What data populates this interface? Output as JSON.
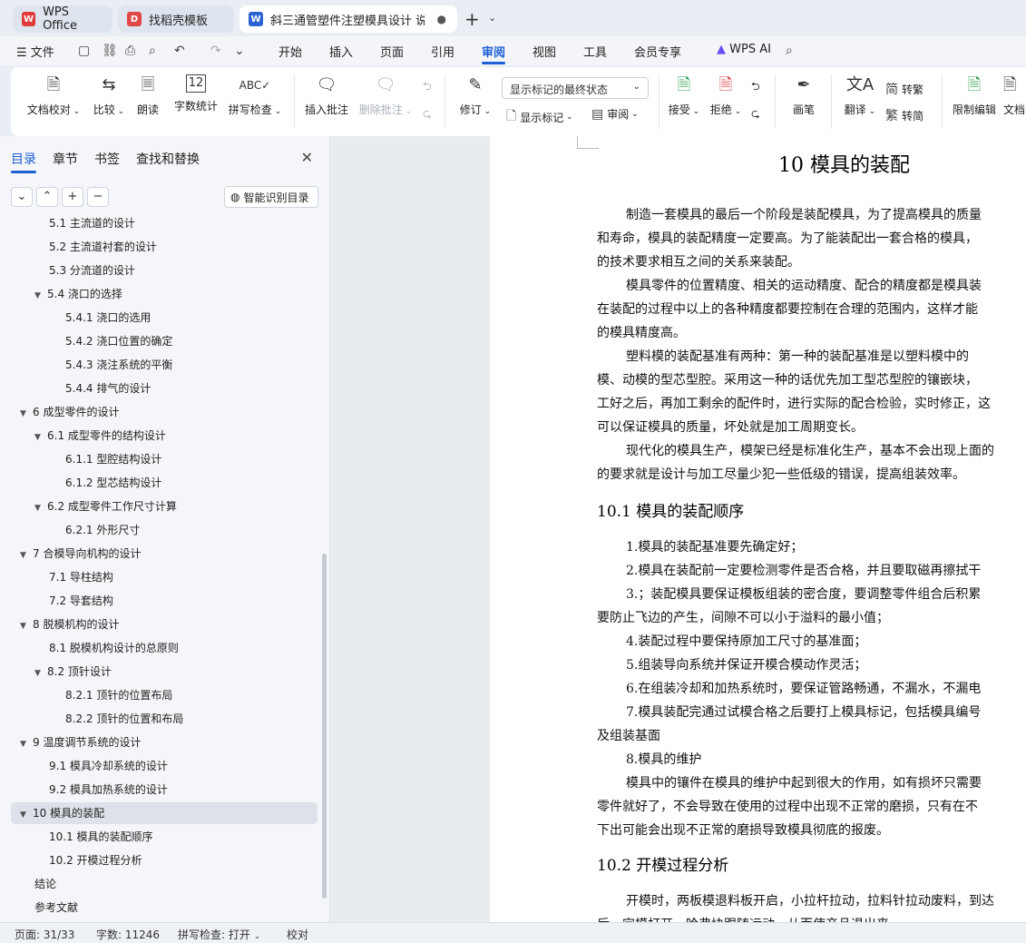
{
  "tabs": [
    {
      "label": "WPS Office",
      "icon": "wps-logo-icon",
      "color": "#e03a3a"
    },
    {
      "label": "找稻壳模板",
      "icon": "docer-icon",
      "color": "#e04848"
    },
    {
      "label": "斜三通管塑件注塑模具设计 说",
      "icon": "writer-doc-icon",
      "color": "#2b62d6"
    }
  ],
  "menu": {
    "file": "文件",
    "items": [
      "开始",
      "插入",
      "页面",
      "引用",
      "审阅",
      "视图",
      "工具",
      "会员专享"
    ],
    "active": "审阅",
    "wps_ai": "WPS AI"
  },
  "ribbon": {
    "doc_check": "文档校对",
    "compare": "比较",
    "read_aloud": "朗读",
    "word_count": "字数统计",
    "spell_check": "拼写检查",
    "insert_comment": "插入批注",
    "delete_comment": "删除批注",
    "revise": "修订",
    "display_mode": "显示标记的最终状态",
    "show_markup": "显示标记",
    "review": "审阅",
    "accept": "接受",
    "reject": "拒绝",
    "draw": "画笔",
    "translate": "翻译",
    "to_traditional": "转繁",
    "to_simplified": "转简",
    "restrict_edit": "限制编辑",
    "doc_right": "文档"
  },
  "panel": {
    "tabs": [
      "目录",
      "章节",
      "书签",
      "查找和替换"
    ],
    "active_tab": "目录",
    "smart_toc": "智能识别目录"
  },
  "toc": [
    {
      "text": "5.1 主流道的设计",
      "level": 2,
      "arrow": false
    },
    {
      "text": "5.2 主流道衬套的设计",
      "level": 2,
      "arrow": false
    },
    {
      "text": "5.3 分流道的设计",
      "level": 2,
      "arrow": false
    },
    {
      "text": "5.4 浇口的选择",
      "level": 2,
      "arrow": true
    },
    {
      "text": "5.4.1 浇口的选用",
      "level": 3,
      "arrow": false
    },
    {
      "text": "5.4.2 浇口位置的确定",
      "level": 3,
      "arrow": false
    },
    {
      "text": "5.4.3 浇注系统的平衡",
      "level": 3,
      "arrow": false
    },
    {
      "text": "5.4.4 排气的设计",
      "level": 3,
      "arrow": false
    },
    {
      "text": "6 成型零件的设计",
      "level": 1,
      "arrow": true
    },
    {
      "text": "6.1 成型零件的结构设计",
      "level": 2,
      "arrow": true
    },
    {
      "text": "6.1.1 型腔结构设计",
      "level": 3,
      "arrow": false
    },
    {
      "text": "6.1.2 型芯结构设计",
      "level": 3,
      "arrow": false
    },
    {
      "text": "6.2 成型零件工作尺寸计算",
      "level": 2,
      "arrow": true
    },
    {
      "text": "6.2.1 外形尺寸",
      "level": 3,
      "arrow": false
    },
    {
      "text": "7 合模导向机构的设计",
      "level": 1,
      "arrow": true
    },
    {
      "text": "7.1 导柱结构",
      "level": 2,
      "arrow": false
    },
    {
      "text": "7.2 导套结构",
      "level": 2,
      "arrow": false
    },
    {
      "text": "8 脱模机构的设计",
      "level": 1,
      "arrow": true
    },
    {
      "text": "8.1 脱模机构设计的总原则",
      "level": 2,
      "arrow": false
    },
    {
      "text": "8.2 顶针设计",
      "level": 2,
      "arrow": true
    },
    {
      "text": "8.2.1 顶针的位置布局",
      "level": 3,
      "arrow": false
    },
    {
      "text": "8.2.2 顶针的位置和布局",
      "level": 3,
      "arrow": false
    },
    {
      "text": "9 温度调节系统的设计",
      "level": 1,
      "arrow": true
    },
    {
      "text": "9.1 模具冷却系统的设计",
      "level": 2,
      "arrow": false
    },
    {
      "text": "9.2 模具加热系统的设计",
      "level": 2,
      "arrow": false
    },
    {
      "text": "10 模具的装配",
      "level": 1,
      "arrow": true,
      "selected": true
    },
    {
      "text": "10.1 模具的装配顺序",
      "level": 2,
      "arrow": false
    },
    {
      "text": "10.2 开模过程分析",
      "level": 2,
      "arrow": false
    },
    {
      "text": "结论",
      "level": 1,
      "arrow": false
    },
    {
      "text": "参考文献",
      "level": 1,
      "arrow": false
    }
  ],
  "document": {
    "title": "10  模具的装配",
    "lines_a": [
      {
        "text": "制造一套模具的最后一个阶段是装配模具，为了提高模具的质量",
        "indent": true
      },
      {
        "text": "和寿命，模具的装配精度一定要高。为了能装配出一套合格的模具，",
        "indent": false
      },
      {
        "text": "的技术要求相互之间的关系来装配。",
        "indent": false
      },
      {
        "text": "模具零件的位置精度、相关的运动精度、配合的精度都是模具装",
        "indent": true
      },
      {
        "text": "在装配的过程中以上的各种精度都要控制在合理的范围内，这样才能",
        "indent": false
      },
      {
        "text": "的模具精度高。",
        "indent": false
      },
      {
        "text": "塑料模的装配基准有两种：第一种的装配基准是以塑料模中的",
        "indent": true
      },
      {
        "text": "模、动模的型芯型腔。采用这一种的话优先加工型芯型腔的镶嵌块，",
        "indent": false
      },
      {
        "text": "工好之后，再加工剩余的配件时，进行实际的配合检验，实时修正，这",
        "indent": false
      },
      {
        "text": "可以保证模具的质量，坏处就是加工周期变长。",
        "indent": false
      },
      {
        "text": "现代化的模具生产，模架已经是标准化生产，基本不会出现上面的",
        "indent": true
      },
      {
        "text": "的要求就是设计与加工尽量少犯一些低级的错误，提高组装效率。",
        "indent": false
      }
    ],
    "h2_1": "10.1  模具的装配顺序",
    "lines_b": [
      {
        "text": "1.模具的装配基准要先确定好；",
        "indent": true
      },
      {
        "text": "2.模具在装配前一定要检测零件是否合格，并且要取磁再擦拭干",
        "indent": true
      },
      {
        "text": "3.；装配模具要保证模板组装的密合度，要调整零件组合后积累",
        "indent": true
      },
      {
        "text": "要防止飞边的产生，间隙不可以小于溢料的最小值；",
        "indent": false
      },
      {
        "text": "4.装配过程中要保持原加工尺寸的基准面；",
        "indent": true
      },
      {
        "text": "5.组装导向系统并保证开模合模动作灵活；",
        "indent": true
      },
      {
        "text": "6.在组装冷却和加热系统时，要保证管路畅通，不漏水，不漏电",
        "indent": true
      },
      {
        "text": "7.模具装配完通过试模合格之后要打上模具标记，包括模具编号",
        "indent": true
      },
      {
        "text": "及组装基面",
        "indent": false
      },
      {
        "text": "8.模具的维护",
        "indent": true
      },
      {
        "text": "模具中的镶件在模具的维护中起到很大的作用，如有损坏只需要",
        "indent": true
      },
      {
        "text": "零件就好了，不会导致在使用的过程中出现不正常的磨损，只有在不",
        "indent": false
      },
      {
        "text": "下出可能会出现不正常的磨损导致模具彻底的报废。",
        "indent": false
      }
    ],
    "h2_2": "10.2  开模过程分析",
    "lines_c": [
      {
        "text": "开模时，两板模退料板开启，小拉杆拉动，拉料针拉动废料，到达",
        "indent": true
      },
      {
        "text": "后，定模打开，哈弗块跟随运动，从而使产品退出来。",
        "indent": false
      }
    ]
  },
  "status": {
    "page": "页面: 31/33",
    "words": "字数: 11246",
    "spell": "拼写检查: 打开",
    "proof": "校对"
  }
}
